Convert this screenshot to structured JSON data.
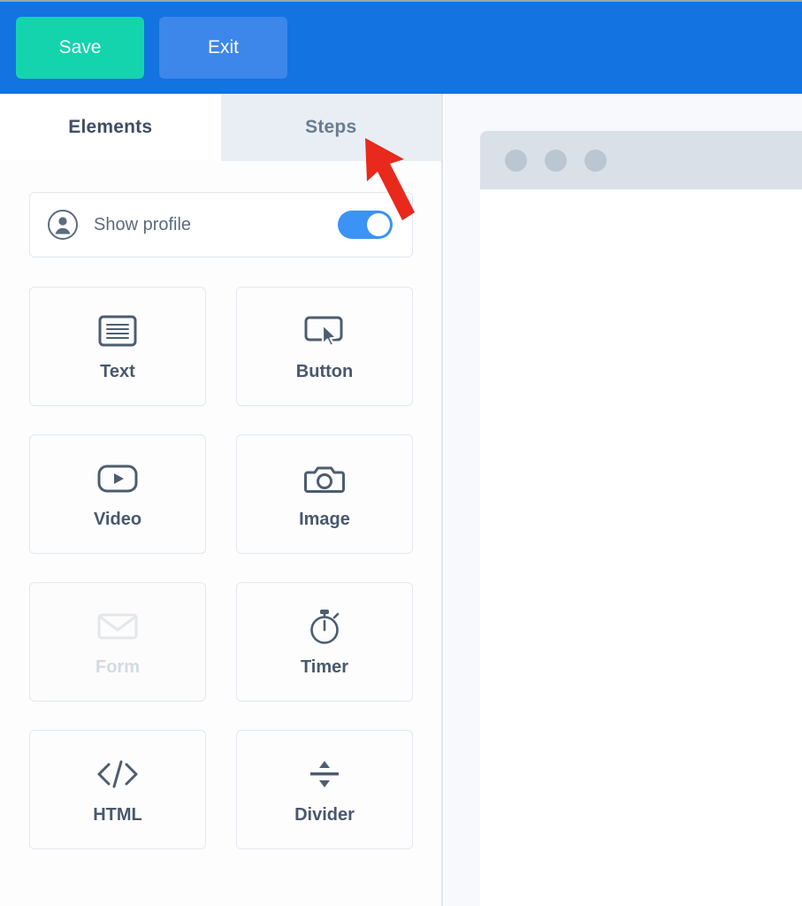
{
  "topbar": {
    "background_color": "#1373e0",
    "buttons": [
      {
        "name": "save",
        "label": "Save",
        "color": "#14d4ad"
      },
      {
        "name": "exit",
        "label": "Exit",
        "color": "#3d86ea"
      }
    ]
  },
  "sidebar": {
    "tabs": [
      {
        "label": "Elements",
        "active": true
      },
      {
        "label": "Steps",
        "active": false
      }
    ],
    "profile_row": {
      "icon": "user-circle-icon",
      "label": "Show profile",
      "toggle_state": "on",
      "toggle_color": "#3a93f5"
    },
    "elements": [
      {
        "label": "Text",
        "icon": "text-lines-icon",
        "disabled": false
      },
      {
        "label": "Button",
        "icon": "button-cursor-icon",
        "disabled": false
      },
      {
        "label": "Video",
        "icon": "video-play-icon",
        "disabled": false
      },
      {
        "label": "Image",
        "icon": "camera-icon",
        "disabled": false
      },
      {
        "label": "Form",
        "icon": "envelope-icon",
        "disabled": true
      },
      {
        "label": "Timer",
        "icon": "stopwatch-icon",
        "disabled": false
      },
      {
        "label": "HTML",
        "icon": "code-brackets-icon",
        "disabled": false
      },
      {
        "label": "Divider",
        "icon": "divider-arrows-icon",
        "disabled": false
      }
    ]
  },
  "canvas": {
    "preview": {
      "title_dots": 3,
      "titlebar_color": "#d9e0e7",
      "dot_color": "#bac6d1"
    }
  },
  "annotation": {
    "arrow_color": "#e8291c",
    "points_to": "Steps"
  }
}
